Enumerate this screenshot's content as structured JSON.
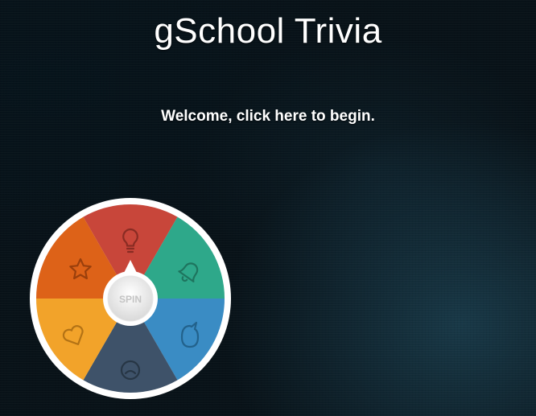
{
  "app": {
    "title": "gSchool Trivia",
    "welcome": "Welcome, click here to begin."
  },
  "wheel": {
    "spin_label": "SPIN",
    "segments": [
      {
        "name": "red",
        "color": "#c8463a",
        "icon": "lightbulb-icon"
      },
      {
        "name": "green",
        "color": "#2ea88a",
        "icon": "bell-icon"
      },
      {
        "name": "blue",
        "color": "#3a8cc4",
        "icon": "speech-bubble-icon"
      },
      {
        "name": "navy",
        "color": "#3e5269",
        "icon": "face-icon"
      },
      {
        "name": "yellow",
        "color": "#f2a32a",
        "icon": "heart-icon"
      },
      {
        "name": "orange",
        "color": "#dd6218",
        "icon": "star-icon"
      }
    ],
    "rim_color": "#ffffff"
  }
}
